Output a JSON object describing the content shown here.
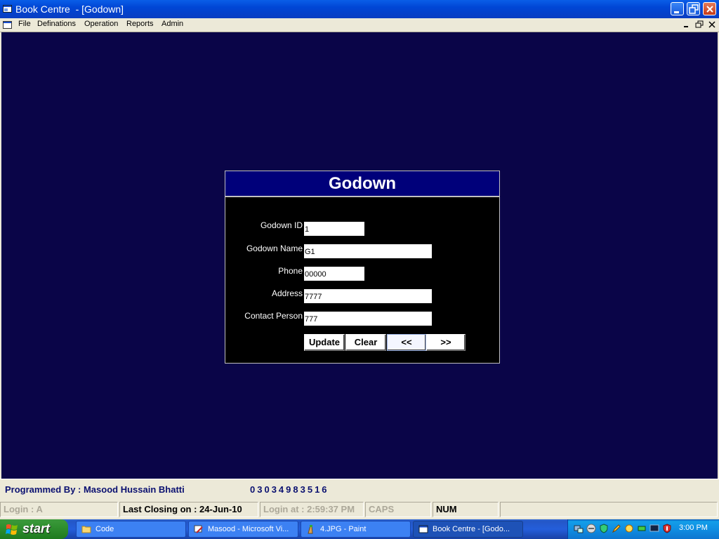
{
  "window": {
    "title": "Book Centre  - [Godown]"
  },
  "menu": {
    "items": [
      "File",
      "Definations",
      "Operation",
      "Reports",
      "Admin"
    ]
  },
  "form": {
    "title": "Godown",
    "fields": [
      {
        "label": "Godown ID",
        "value": "1"
      },
      {
        "label": "Godown Name",
        "value": "G1"
      },
      {
        "label": "Phone",
        "value": "00000"
      },
      {
        "label": "Address",
        "value": "7777"
      },
      {
        "label": "Contact Person",
        "value": "777"
      }
    ],
    "buttons": {
      "update": "Update",
      "clear": "Clear",
      "prev": "<<",
      "next": ">>"
    }
  },
  "status": {
    "programmer": "Programmed By : Masood Hussain Bhatti",
    "phone": "03034983516",
    "login": "Login :  A",
    "last_closing": "Last Closing on : 24-Jun-10",
    "login_at": "Login at : 2:59:37 PM",
    "caps": "CAPS",
    "num": "NUM"
  },
  "taskbar": {
    "start_label": "start",
    "tasks": [
      {
        "label": "Code",
        "icon": "folder-icon"
      },
      {
        "label": "Masood - Microsoft Vi...",
        "icon": "visual-studio-icon"
      },
      {
        "label": "4.JPG - Paint",
        "icon": "paint-icon"
      },
      {
        "label": "Book Centre  - [Godo...",
        "icon": "app-window-icon"
      }
    ],
    "clock": "3:00 PM"
  },
  "colors": {
    "mdi_background": "#0a0548",
    "form_header": "#00007a",
    "status_text": "#0a1070"
  }
}
